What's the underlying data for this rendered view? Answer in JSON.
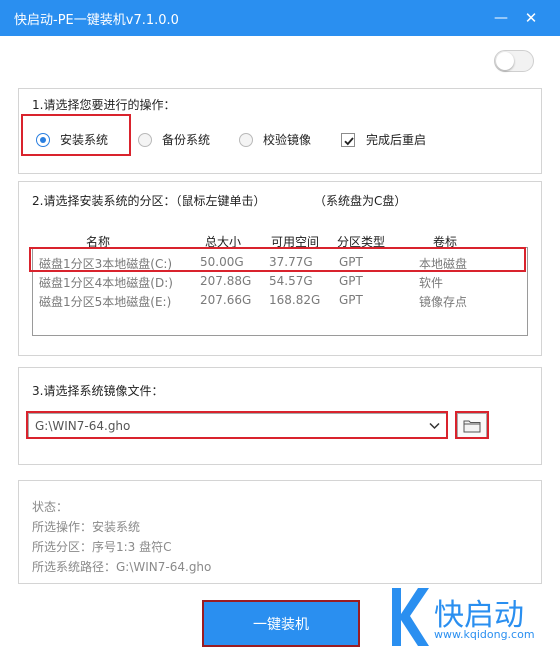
{
  "window": {
    "title": "快启动-PE一键装机v7.1.0.0",
    "minimize_glyph": "—",
    "close_glyph": "✕",
    "accent_color": "#2a8ff0"
  },
  "toggle": {
    "state": "off"
  },
  "section1": {
    "title": "1.请选择您要进行的操作：",
    "options": [
      {
        "label": "安装系统",
        "selected": true
      },
      {
        "label": "备份系统",
        "selected": false
      },
      {
        "label": "校验镜像",
        "selected": false
      }
    ],
    "reboot_checkbox": {
      "label": "完成后重启",
      "checked": true
    }
  },
  "section2": {
    "title": "2.请选择安装系统的分区：（鼠标左键单击）",
    "note": "（系统盘为C盘）",
    "columns": [
      "名称",
      "总大小",
      "可用空间",
      "分区类型",
      "卷标"
    ],
    "rows": [
      [
        "磁盘1分区3本地磁盘(C:)",
        "50.00G",
        "37.77G",
        "GPT",
        "本地磁盘"
      ],
      [
        "磁盘1分区4本地磁盘(D:)",
        "207.88G",
        "54.57G",
        "GPT",
        "软件"
      ],
      [
        "磁盘1分区5本地磁盘(E:)",
        "207.66G",
        "168.82G",
        "GPT",
        "镜像存点"
      ]
    ]
  },
  "section3": {
    "title": "3.请选择系统镜像文件：",
    "image_path": "G:\\WIN7-64.gho"
  },
  "status": {
    "label": "状态：",
    "operation": "所选操作：安装系统",
    "partition": "所选分区：序号1:3    盘符C",
    "image": "所选系统路径：G:\\WIN7-64.gho"
  },
  "install_button": "一键装机",
  "brand": {
    "letter": "K",
    "name": "快启动",
    "url": "www.kqidong.com"
  }
}
